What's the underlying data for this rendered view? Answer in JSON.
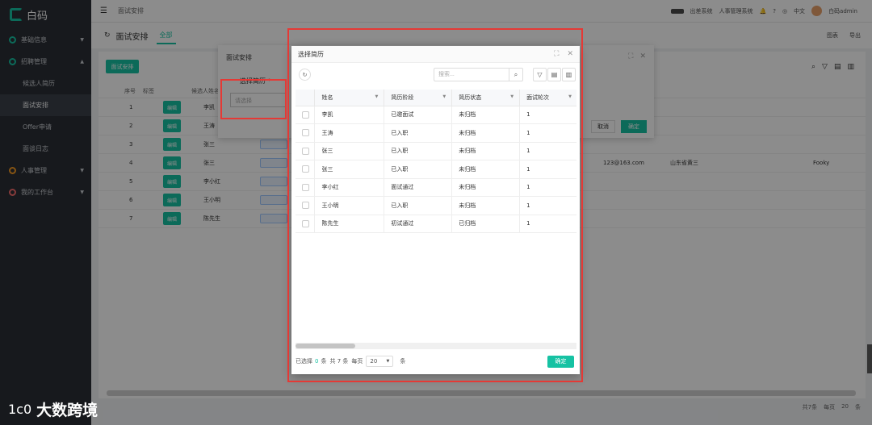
{
  "app": {
    "name": "白码"
  },
  "sidebar": {
    "groups": [
      {
        "label": "基础信息"
      },
      {
        "label": "招聘管理",
        "children": [
          "候选人简历",
          "面试安排",
          "Offer申请",
          "面谈日志"
        ]
      },
      {
        "label": "人事管理"
      },
      {
        "label": "我的工作台"
      }
    ]
  },
  "topbar": {
    "breadcrumb": "面试安排",
    "pill": "",
    "link1": "出差系统",
    "link2": "人事管理系统",
    "lang": "中文",
    "user": "白码admin"
  },
  "page": {
    "title": "面试安排",
    "tab": "全部",
    "right1": "图表",
    "right2": "导出",
    "new_button": "面试安排"
  },
  "background_table": {
    "headers": [
      "序号",
      "标签",
      "候选人姓名"
    ],
    "rows": [
      {
        "n": "1",
        "name": "李凯"
      },
      {
        "n": "2",
        "name": "王涛"
      },
      {
        "n": "3",
        "name": "张三"
      },
      {
        "n": "4",
        "name": "张三"
      },
      {
        "n": "5",
        "name": "李小红"
      },
      {
        "n": "6",
        "name": "王小明"
      },
      {
        "n": "7",
        "name": "陈先生"
      }
    ],
    "row_button": "编辑",
    "email": "123@163.com",
    "addr": "山东省黄三",
    "person": "Fooky",
    "pager": {
      "total": "共7条",
      "per": "每页",
      "size": "20",
      "unit": "条"
    }
  },
  "dialog1": {
    "title": "面试安排",
    "field_label": "选择简历",
    "required_mark": "*",
    "placeholder": "请选择",
    "cancel": "取消",
    "ok": "确定"
  },
  "dialog2": {
    "title": "选择简历",
    "search_placeholder": "搜索...",
    "columns": [
      "姓名",
      "简历阶段",
      "简历状态",
      "面试轮次"
    ],
    "rows": [
      {
        "name": "李凯",
        "stage": "已邀面试",
        "status": "未归档",
        "round": "1"
      },
      {
        "name": "王涛",
        "stage": "已入职",
        "status": "未归档",
        "round": "1"
      },
      {
        "name": "张三",
        "stage": "已入职",
        "status": "未归档",
        "round": "1"
      },
      {
        "name": "张三",
        "stage": "已入职",
        "status": "未归档",
        "round": "1"
      },
      {
        "name": "李小红",
        "stage": "面试通过",
        "status": "未归档",
        "round": "1"
      },
      {
        "name": "王小明",
        "stage": "已入职",
        "status": "未归档",
        "round": "1"
      },
      {
        "name": "陈先生",
        "stage": "初试通过",
        "status": "已归档",
        "round": "1"
      }
    ],
    "footer": {
      "selected_prefix": "已选择",
      "selected_count": "0",
      "selected_suffix": "条",
      "total": "共 7 条",
      "per_page": "每页",
      "page_size": "20",
      "page_unit": "条",
      "ok": "确定"
    }
  },
  "watermark": {
    "logo": "1c0",
    "text": "大数跨境"
  },
  "colors": {
    "accent": "#16c2a3",
    "annotation": "#e53935",
    "sidebar_bg": "#2b2f36"
  }
}
